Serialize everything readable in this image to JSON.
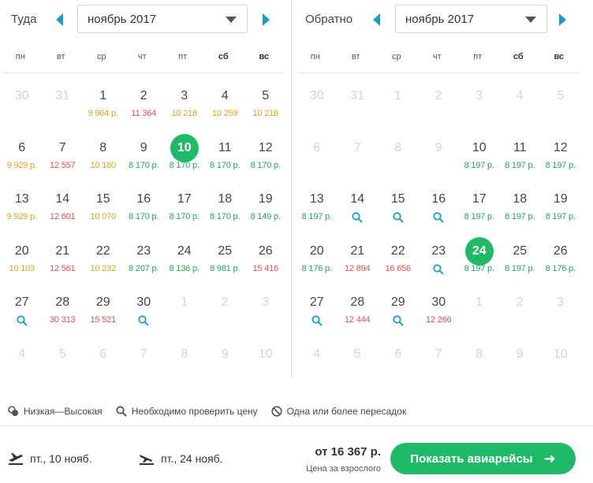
{
  "outbound": {
    "title": "Туда",
    "month": "ноябрь 2017",
    "weekdays": [
      "пн",
      "вт",
      "ср",
      "чт",
      "пт",
      "сб",
      "вс"
    ],
    "weeks": [
      [
        {
          "d": "30",
          "m": true
        },
        {
          "d": "31",
          "m": true
        },
        {
          "d": "1",
          "p": "9 964 р.",
          "c": "o"
        },
        {
          "d": "2",
          "p": "11 364",
          "c": "r"
        },
        {
          "d": "3",
          "p": "10 218",
          "c": "o"
        },
        {
          "d": "4",
          "p": "10 259",
          "c": "o"
        },
        {
          "d": "5",
          "p": "10 218",
          "c": "o"
        }
      ],
      [
        {
          "d": "6",
          "p": "9 929 р.",
          "c": "o"
        },
        {
          "d": "7",
          "p": "12 557",
          "c": "r"
        },
        {
          "d": "8",
          "p": "10 180",
          "c": "o"
        },
        {
          "d": "9",
          "p": "8 170 р.",
          "c": "g"
        },
        {
          "d": "10",
          "p": "8 170 р.",
          "c": "g",
          "sel": true
        },
        {
          "d": "11",
          "p": "8 170 р.",
          "c": "g"
        },
        {
          "d": "12",
          "p": "8 170 р.",
          "c": "g"
        }
      ],
      [
        {
          "d": "13",
          "p": "9 929 р.",
          "c": "o"
        },
        {
          "d": "14",
          "p": "12 601",
          "c": "r"
        },
        {
          "d": "15",
          "p": "10 070",
          "c": "o"
        },
        {
          "d": "16",
          "p": "8 170 р.",
          "c": "g"
        },
        {
          "d": "17",
          "p": "8 170 р.",
          "c": "g"
        },
        {
          "d": "18",
          "p": "8 170 р.",
          "c": "g"
        },
        {
          "d": "19",
          "p": "8 149 р.",
          "c": "g"
        }
      ],
      [
        {
          "d": "20",
          "p": "10 103",
          "c": "o"
        },
        {
          "d": "21",
          "p": "12 561",
          "c": "r"
        },
        {
          "d": "22",
          "p": "10 232",
          "c": "o"
        },
        {
          "d": "23",
          "p": "8 207 р.",
          "c": "g"
        },
        {
          "d": "24",
          "p": "8 136 р.",
          "c": "g"
        },
        {
          "d": "25",
          "p": "8 981 р.",
          "c": "g"
        },
        {
          "d": "26",
          "p": "15 416",
          "c": "r"
        }
      ],
      [
        {
          "d": "27",
          "s": true
        },
        {
          "d": "28",
          "p": "30 313",
          "c": "r"
        },
        {
          "d": "29",
          "p": "15 521",
          "c": "r"
        },
        {
          "d": "30",
          "s": true
        },
        {
          "d": "1",
          "m": true
        },
        {
          "d": "2",
          "m": true
        },
        {
          "d": "3",
          "m": true
        }
      ],
      [
        {
          "d": "4",
          "m": true
        },
        {
          "d": "5",
          "m": true
        },
        {
          "d": "6",
          "m": true
        },
        {
          "d": "7",
          "m": true
        },
        {
          "d": "8",
          "m": true
        },
        {
          "d": "9",
          "m": true
        },
        {
          "d": "10",
          "m": true
        }
      ]
    ]
  },
  "return": {
    "title": "Обратно",
    "month": "ноябрь 2017",
    "weekdays": [
      "пн",
      "вт",
      "ср",
      "чт",
      "пт",
      "сб",
      "вс"
    ],
    "weeks": [
      [
        {
          "d": "30",
          "m": true
        },
        {
          "d": "31",
          "m": true
        },
        {
          "d": "1",
          "m": true
        },
        {
          "d": "2",
          "m": true
        },
        {
          "d": "3",
          "m": true
        },
        {
          "d": "4",
          "m": true
        },
        {
          "d": "5",
          "m": true
        }
      ],
      [
        {
          "d": "6",
          "m": true
        },
        {
          "d": "7",
          "m": true
        },
        {
          "d": "8",
          "m": true
        },
        {
          "d": "9",
          "m": true
        },
        {
          "d": "10",
          "p": "8 197 р.",
          "c": "g"
        },
        {
          "d": "11",
          "p": "8 197 р.",
          "c": "g"
        },
        {
          "d": "12",
          "p": "8 197 р.",
          "c": "g"
        }
      ],
      [
        {
          "d": "13",
          "p": "8 197 р.",
          "c": "g"
        },
        {
          "d": "14",
          "s": true
        },
        {
          "d": "15",
          "s": true
        },
        {
          "d": "16",
          "s": true
        },
        {
          "d": "17",
          "p": "8 197 р.",
          "c": "g"
        },
        {
          "d": "18",
          "p": "8 197 р.",
          "c": "g"
        },
        {
          "d": "19",
          "p": "8 197 р.",
          "c": "g"
        }
      ],
      [
        {
          "d": "20",
          "p": "8 176 р.",
          "c": "g"
        },
        {
          "d": "21",
          "p": "12 894",
          "c": "r"
        },
        {
          "d": "22",
          "p": "16 656",
          "c": "r"
        },
        {
          "d": "23",
          "s": true
        },
        {
          "d": "24",
          "p": "8 197 р.",
          "c": "g",
          "sel": true
        },
        {
          "d": "25",
          "p": "8 197 р.",
          "c": "g"
        },
        {
          "d": "26",
          "p": "8 176 р.",
          "c": "g"
        }
      ],
      [
        {
          "d": "27",
          "s": true
        },
        {
          "d": "28",
          "p": "12 444",
          "c": "r"
        },
        {
          "d": "29",
          "s": true
        },
        {
          "d": "30",
          "p": "12 266",
          "c": "r"
        },
        {
          "d": "1",
          "m": true
        },
        {
          "d": "2",
          "m": true
        },
        {
          "d": "3",
          "m": true
        }
      ],
      [
        {
          "d": "4",
          "m": true
        },
        {
          "d": "5",
          "m": true
        },
        {
          "d": "6",
          "m": true
        },
        {
          "d": "7",
          "m": true
        },
        {
          "d": "8",
          "m": true
        },
        {
          "d": "9",
          "m": true
        },
        {
          "d": "10",
          "m": true
        }
      ]
    ]
  },
  "legend": {
    "low_high": "Низкая—Высокая",
    "check_price": "Необходимо проверить цену",
    "stops": "Одна или более пересадок"
  },
  "footer": {
    "outbound_date": "пт., 10 нояб.",
    "return_date": "пт., 24 нояб.",
    "price": "от 16 367 р.",
    "price_note": "Цена за взрослого",
    "show_button": "Показать авиарейсы"
  },
  "colors": {
    "accent": "#1fba68",
    "arrow": "#1a9ec9",
    "price_low": "#24a35e",
    "price_mid": "#e3a11b",
    "price_high": "#e5504e"
  },
  "icons": {
    "prev": "chevron-left-icon",
    "next": "chevron-right-icon",
    "check_price": "search-icon",
    "stops": "no-entry-icon",
    "low_high": "price-range-icon",
    "outbound": "plane-departure-icon",
    "return": "plane-arrival-icon"
  }
}
